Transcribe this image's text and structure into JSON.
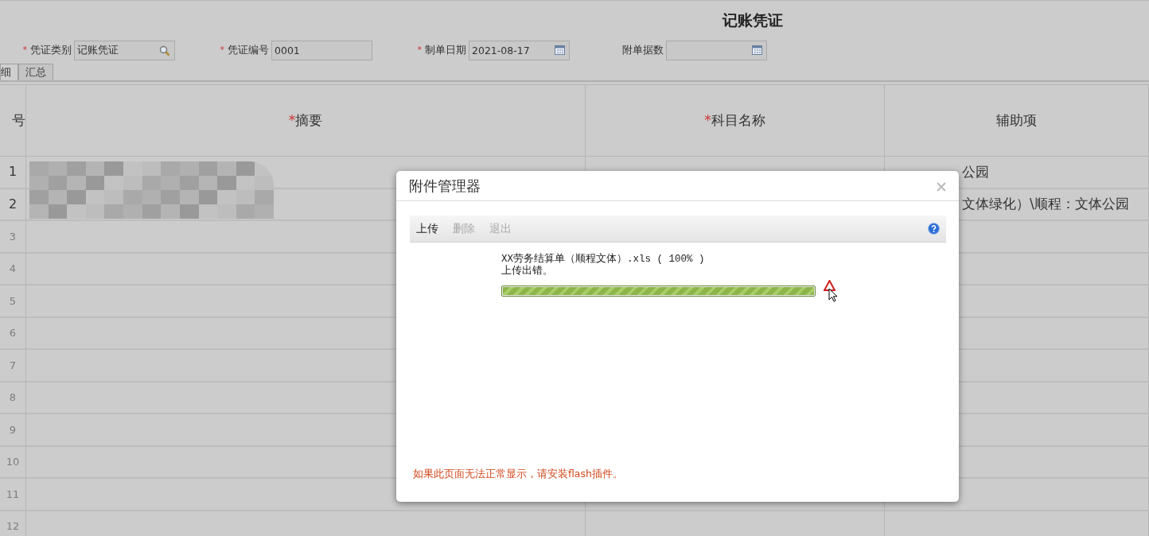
{
  "page_title": "记账凭证",
  "form_fields": [
    {
      "label": "凭证类别",
      "required_mark": "*",
      "value": "记账凭证",
      "kind": "lookup"
    },
    {
      "label": "凭证编号",
      "required_mark": "*",
      "value": "0001",
      "kind": "text"
    },
    {
      "label": "制单日期",
      "required_mark": "*",
      "value": "2021-08-17",
      "kind": "date"
    },
    {
      "label": "附单据数",
      "kind": "date"
    }
  ],
  "tabs": [
    {
      "label": "细",
      "selected": true
    },
    {
      "label": "汇总",
      "selected": false
    }
  ],
  "table": {
    "columns": [
      {
        "label": "号"
      },
      {
        "label": "摘要",
        "required_mark": "*"
      },
      {
        "label": "科目名称",
        "required_mark": "*"
      },
      {
        "label": "辅助项"
      }
    ],
    "summary_redacted": true,
    "rows": [
      {
        "number": "1",
        "auxiliary": "公园"
      },
      {
        "number": "2",
        "auxiliary": "文体绿化）\\顺程：文体公园"
      },
      {
        "number": "3"
      },
      {
        "number": "4"
      },
      {
        "number": "5"
      },
      {
        "number": "6"
      },
      {
        "number": "7"
      },
      {
        "number": "8"
      },
      {
        "number": "9"
      },
      {
        "number": "10"
      },
      {
        "number": "11"
      },
      {
        "number": "12"
      }
    ]
  },
  "dialog": {
    "title": "附件管理器",
    "toolbar": [
      {
        "label": "上传",
        "disabled": false
      },
      {
        "label": "删除",
        "disabled": true
      },
      {
        "label": "退出",
        "disabled": true
      }
    ],
    "files": [
      {
        "name": "XX劳务结算单（顺程文体）.xls ( 100% )",
        "status": "上传出错。",
        "level": 1,
        "error": true
      }
    ],
    "note": "如果此页面无法正常显示，请安装flash插件。"
  }
}
